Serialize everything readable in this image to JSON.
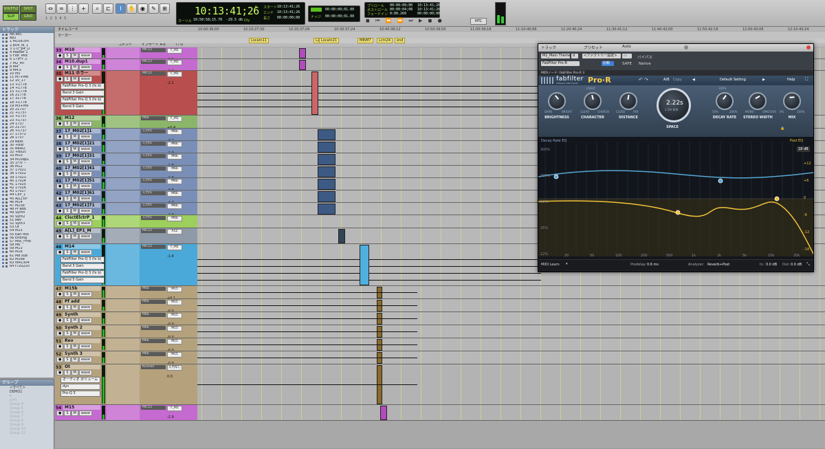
{
  "toolbar": {
    "modes": [
      "SHUFFLE",
      "SPOT",
      "SLIP",
      "GRID"
    ],
    "main_counter": "10:13:41;26",
    "counter_arrow": "▾",
    "counter_sub": "カーソル",
    "cursor_time": "10:50:58;15.70",
    "cursor_db": "-29.5 db",
    "dly_label": "Dly",
    "start_label": "スタート",
    "end_label": "エンド",
    "length_label": "長さ",
    "start_value": "10:13:41;26",
    "end_value": "10:13:41;26",
    "length_value": "00:00:00;00",
    "nudge_label": "ナッジ",
    "nudge_value": "00:00:00;01.00",
    "grid_value": "00:00:00;01.00",
    "preroll_label": "プリロール",
    "postroll_label": "ポストロール",
    "fadein_label": "フェードイン",
    "preroll_value": "00:00:00;00",
    "postroll_value": "00:00:04;08",
    "fadein_value": "0:00.260",
    "t_start_value": "10:13:41;26",
    "t_end_value": "10:13:41;26",
    "t_len_value": "00:00:00;00",
    "mtc": "MTC"
  },
  "tracklist": {
    "header": "トラック",
    "items": [
      "N6.REC",
      "ep2",
      "1 M15b.cm",
      "2 p04_ib_1",
      "3 17c_p4_D",
      "4 Master 1",
      "5 Fldr_Msc",
      "6 17ボイス",
      "7 M2_MT",
      "8 M4",
      "9 M4.5",
      "10 M5",
      "11 M7+M8",
      "12 10_17",
      "13 +1778",
      "14 +1778",
      "15 +1778",
      "16 21778",
      "17 31778",
      "18 +1778",
      "19 M3+M9",
      "20 21737",
      "21 +1737",
      "22 +1737",
      "23 +1737",
      "24 1737",
      "25 21737",
      "26 +1737",
      "27 17372",
      "28 1737",
      "29 Bass",
      "30 +Bsc",
      "31 Bass2",
      "32 +Bs2c",
      "33 M10",
      "34 M10dp1",
      "35 1ﾄﾘｶﾞｰ",
      "36 M12",
      "37 17021",
      "38 17022",
      "39 17023",
      "40 17024",
      "41 17025",
      "42 17026",
      "43 17027",
      "44 CEP_1",
      "45 A[L] EP",
      "46 M14",
      "47 M15b",
      "48 Pf add",
      "49 Synth",
      "50 Synt2",
      "51 Rev",
      "52 Synt3",
      "53 Ot",
      "54 M15",
      "55 Karl Mix",
      "56 Ending",
      "57 Msc_Fm8",
      "58 M6",
      "59 M13",
      "60 M16",
      "61 M8 sub",
      "62 M16b",
      "63 f841304",
      "64 f720220"
    ]
  },
  "groups": {
    "header": "グループ",
    "items": [
      "<すべて>",
      "DEMO1",
      "e",
      "a(4)",
      "Group 4",
      "Group 5",
      "Group 6",
      "Group 7",
      "Group 8",
      "Group 9",
      "Group 10",
      "Group 12"
    ]
  },
  "rulers": {
    "timecode_label": "タイムコード",
    "marker_label": "マーカー",
    "ticks": [
      "10:00:36;00",
      "10:10:27;30",
      "10:20:37;06",
      "10:30:37;24",
      "10:40:38;12",
      "10:50:39;00",
      "11:00:39;18",
      "11:10:40;06",
      "11:20:40;24",
      "11:30:41;12",
      "11:40:42;00",
      "11:50:42;18",
      "12:00:43;06",
      "12:10:43;24"
    ],
    "markers": [
      "Locatn11",
      "L20",
      "Locatn21",
      "M8\\M7",
      "Lctn24",
      "end"
    ]
  },
  "track_headers": {
    "comment": "コメント",
    "inserts": "インサート A-E",
    "io": "I / O"
  },
  "tracks": [
    {
      "num": "33",
      "name": "M10",
      "color": "#c56ad0",
      "ins": "MIC12",
      "io": "F_M1",
      "vol": "-2.2"
    },
    {
      "num": "34",
      "name": "M10.dup1",
      "color": "#c56ad0",
      "ins": "MIC12",
      "io": "F_M1",
      "vol": "-2.3"
    },
    {
      "num": "35",
      "name": "M11 ホラー",
      "color": "#b94e4e",
      "ins": "MIC12",
      "io": "F_M1",
      "vol": "-2.1",
      "plugins": [
        "FabFilter Pro-Q 3 (fx b)",
        "Band 3 Gain",
        "FabFilter Pro-Q 3 (fx b)",
        "Band 5 Gain"
      ]
    },
    {
      "num": "36",
      "name": "M12",
      "color": "#8bb66a",
      "ins": "M6b",
      "io": "F_M1",
      "vol": "+0.4"
    },
    {
      "num": "37",
      "name": "17_M02[1]1",
      "color": "#7a8fb7",
      "ins": "入力/G",
      "io": "M6b",
      "vol": "-3.2"
    },
    {
      "num": "38",
      "name": "17_M02[1]21",
      "color": "#7a8fb7",
      "ins": "入力/G",
      "io": "M6b",
      "vol": "-1.9"
    },
    {
      "num": "39",
      "name": "17_M02[1]31",
      "color": "#7a8fb7",
      "ins": "入力/G",
      "io": "M6b",
      "vol": "-1.8"
    },
    {
      "num": "40",
      "name": "17_M02[1]41",
      "color": "#7a8fb7",
      "ins": "入力/G",
      "io": "M6b",
      "vol": "-1.8"
    },
    {
      "num": "41",
      "name": "17_M02[1]51",
      "color": "#7a8fb7",
      "ins": "入力/G",
      "io": "M6b",
      "vol": "-0.8"
    },
    {
      "num": "42",
      "name": "17_M02[1]61",
      "color": "#7a8fb7",
      "ins": "入力/G",
      "io": "M6b",
      "vol": "-4.4"
    },
    {
      "num": "43",
      "name": "17_M02[1]71",
      "color": "#7a8fb7",
      "ins": "入力/G",
      "io": "M6b",
      "vol": "-2.3"
    },
    {
      "num": "44",
      "name": "ClsctElctrP_1",
      "color": "#9ccf5c",
      "ins": "入力/G",
      "io": "M6b",
      "vol": ""
    },
    {
      "num": "45",
      "name": "A[L]_EP1_M",
      "color": "#8f9aa8",
      "ins": "MIC12",
      "io": "A12",
      "vol": ""
    },
    {
      "num": "46",
      "name": "M14",
      "color": "#4aa9d8",
      "ins": "MIC12",
      "io": "F_M1",
      "vol": "-1.4",
      "plugins": [
        "FabFilter Pro-Q 3 (fx b)",
        "Band 3 Gain",
        "FabFilter Pro-Q 3 (fx b)",
        "Band 5 Gain"
      ]
    },
    {
      "num": "47",
      "name": "M15b",
      "color": "#b5a27c",
      "ins": "M6b",
      "io": "M15",
      "vol": "+0.1"
    },
    {
      "num": "48",
      "name": "Pf add",
      "color": "#b5a27c",
      "ins": "M6b",
      "io": "M15",
      "vol": "-0.0"
    },
    {
      "num": "49",
      "name": "Synth",
      "color": "#b5a27c",
      "ins": "M6b",
      "io": "M15",
      "vol": "-0.0"
    },
    {
      "num": "50",
      "name": "Synth 2",
      "color": "#b5a27c",
      "ins": "M6b",
      "io": "M15",
      "vol": "-0.0"
    },
    {
      "num": "51",
      "name": "Rev",
      "color": "#b5a27c",
      "ins": "M6b",
      "io": "M15",
      "vol": "-0.0"
    },
    {
      "num": "52",
      "name": "Synth 3",
      "color": "#b5a27c",
      "ins": "M6b",
      "io": "M15",
      "vol": "-0.0"
    },
    {
      "num": "53",
      "name": "Ot",
      "color": "#b5a27c",
      "ins": "Kontakt",
      "io": "入力なし",
      "vol": "0.0",
      "extra": [
        "オーディオ ボリューム",
        "dyn",
        "Pro-Q 3"
      ]
    },
    {
      "num": "54",
      "name": "M15",
      "color": "#c56ad0",
      "ins": "MIC12",
      "io": "F_M1",
      "vol": "-2.9"
    }
  ],
  "plugin": {
    "track_label": "トラック",
    "preset_label": "プリセット",
    "auto_label": "Auto",
    "track_name": "M2_Main Theme",
    "track_suffix": "d",
    "preset_name": "<ファクトリー設定>",
    "plugin_name": "FabFilter Pro-R",
    "compare": "比較",
    "safe": "SAFE",
    "bypass": "バイパス",
    "native": "Native",
    "midi_node": "MIDIノード: FabFilter Pro-R 3",
    "brand": "fabfilter",
    "brand_sub": "software instruments",
    "product": "Pro·R",
    "ab": "A/B",
    "copy": "Copy",
    "preset_setting": "Default Setting",
    "help": "Help",
    "knobs": [
      {
        "label": "BRIGHTNESS",
        "sub_l": "DARK",
        "sub_r": "BRIGHT"
      },
      {
        "label": "CHARACTER",
        "sub_l": "CLEAR",
        "sub_r": "CHORUS",
        "top": "LIVELY"
      },
      {
        "label": "DISTANCE",
        "sub_l": "CLOSE",
        "sub_r": "FAR"
      },
      {
        "label": "DECAY RATE",
        "sub_l": "50%",
        "sub_r": "200%",
        "top": "100%"
      },
      {
        "label": "STEREO WIDTH",
        "sub_l": "MONO",
        "sub_r": "SPACIOUS"
      },
      {
        "label": "MIX",
        "sub_l": "0%",
        "sub_r": "100%"
      }
    ],
    "space_value": "2.22s",
    "space_sub": "2.5th  808",
    "space_label": "SPACE",
    "eq_title": "Decay Rate EQ",
    "post_eq": "Post EQ",
    "db_range": "18 dB",
    "left_scale": [
      "200%",
      "100%",
      "50%",
      "25%",
      "12%"
    ],
    "right_scale": [
      "+12",
      "+6",
      "0",
      "-6",
      "-12",
      "-18"
    ],
    "freq_scale": [
      "20",
      "50",
      "100",
      "200",
      "500",
      "1k",
      "2k",
      "5k",
      "10k",
      "20k"
    ],
    "midi_learn": "MIDI Learn",
    "predelay_label": "Predelay:",
    "predelay_value": "0.6 ms",
    "analyzer_label": "Analyzer:",
    "analyzer_value": "Reverb+Post",
    "in_label": "In:",
    "in_value": "0.0 dB",
    "out_label": "Out:",
    "out_value": "0.0 dB"
  },
  "colors": {
    "eq_blue": "#58a7d6",
    "eq_yellow": "#f2c43a",
    "knob_ring": "#9aa6b3"
  }
}
